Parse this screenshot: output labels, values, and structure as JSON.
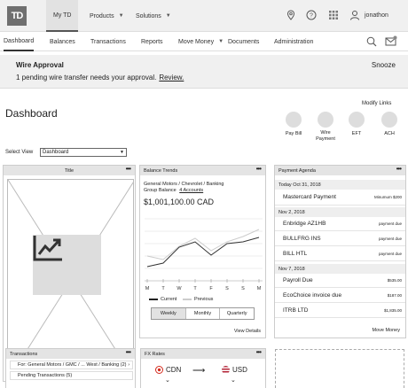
{
  "topnav": {
    "logo": "TD",
    "items": [
      {
        "label": "My TD"
      },
      {
        "label": "Products"
      },
      {
        "label": "Solutions"
      }
    ],
    "username": "jonathon"
  },
  "subnav": {
    "items": [
      {
        "label": "Dashboard"
      },
      {
        "label": "Balances"
      },
      {
        "label": "Transactions"
      },
      {
        "label": "Reports"
      },
      {
        "label": "Move Money"
      },
      {
        "label": "Documents"
      },
      {
        "label": "Administration"
      }
    ]
  },
  "banner": {
    "title": "Wire Approval",
    "text": "1 pending wire transfer needs your approval.",
    "link": "Review.",
    "snooze": "Snooze"
  },
  "page": {
    "title": "Dashboard",
    "modify_links": "Modify Links",
    "select_view_label": "Select View",
    "select_view_value": "Dashboard"
  },
  "quick_links": [
    {
      "label": "Pay Bill"
    },
    {
      "label": "Wire Payment"
    },
    {
      "label": "EFT"
    },
    {
      "label": "ACH"
    }
  ],
  "title_panel": {
    "title": "Title"
  },
  "balance_trends": {
    "title": "Balance Trends",
    "account": "General Motors / Chevrolet / Banking",
    "group_balance_label": "Group Balance",
    "group_balance_link": "4 Accounts",
    "amount": "$1,001,100.00 CAD",
    "days": [
      "M",
      "T",
      "W",
      "T",
      "F",
      "S",
      "S",
      "M"
    ],
    "legend_current": "Current",
    "legend_previous": "Previous",
    "tabs": [
      "Weekly",
      "Monthly",
      "Quarterly"
    ],
    "view_details": "View Details"
  },
  "payment_agenda": {
    "title": "Payment Agenda",
    "sections": [
      {
        "date": "Today Oct 31, 2018",
        "rows": [
          {
            "name": "Mastercard Payment",
            "right": "Minumum $200"
          }
        ]
      },
      {
        "date": "Nov 2, 2018",
        "rows": [
          {
            "name": "Enbridge AZ1HB",
            "right": "payment due"
          },
          {
            "name": "BULLFRG INS",
            "right": "payment due"
          },
          {
            "name": "BILL HTL",
            "right": "payment due"
          }
        ]
      },
      {
        "date": "Nov 7, 2018",
        "rows": [
          {
            "name": "Payroll Due",
            "right": "$535.00"
          },
          {
            "name": "EcoChoice invoice due",
            "right": "$187.00"
          },
          {
            "name": "ITRB LTD",
            "right": "$1,835.00"
          }
        ]
      }
    ],
    "move_money": "Move Money"
  },
  "transactions": {
    "title": "Transactions",
    "for_label": "For: General Motors / GMC / ... West / Banking (2)",
    "pending": "Pending Transactions (5)"
  },
  "fx_rates": {
    "title": "FX Rates",
    "from": "CDN",
    "to": "USD"
  },
  "colors": {
    "brand_gray": "#6f6f6f",
    "panel_header": "#e4e4e4",
    "current_line": "#222222",
    "previous_line": "#cccccc"
  }
}
